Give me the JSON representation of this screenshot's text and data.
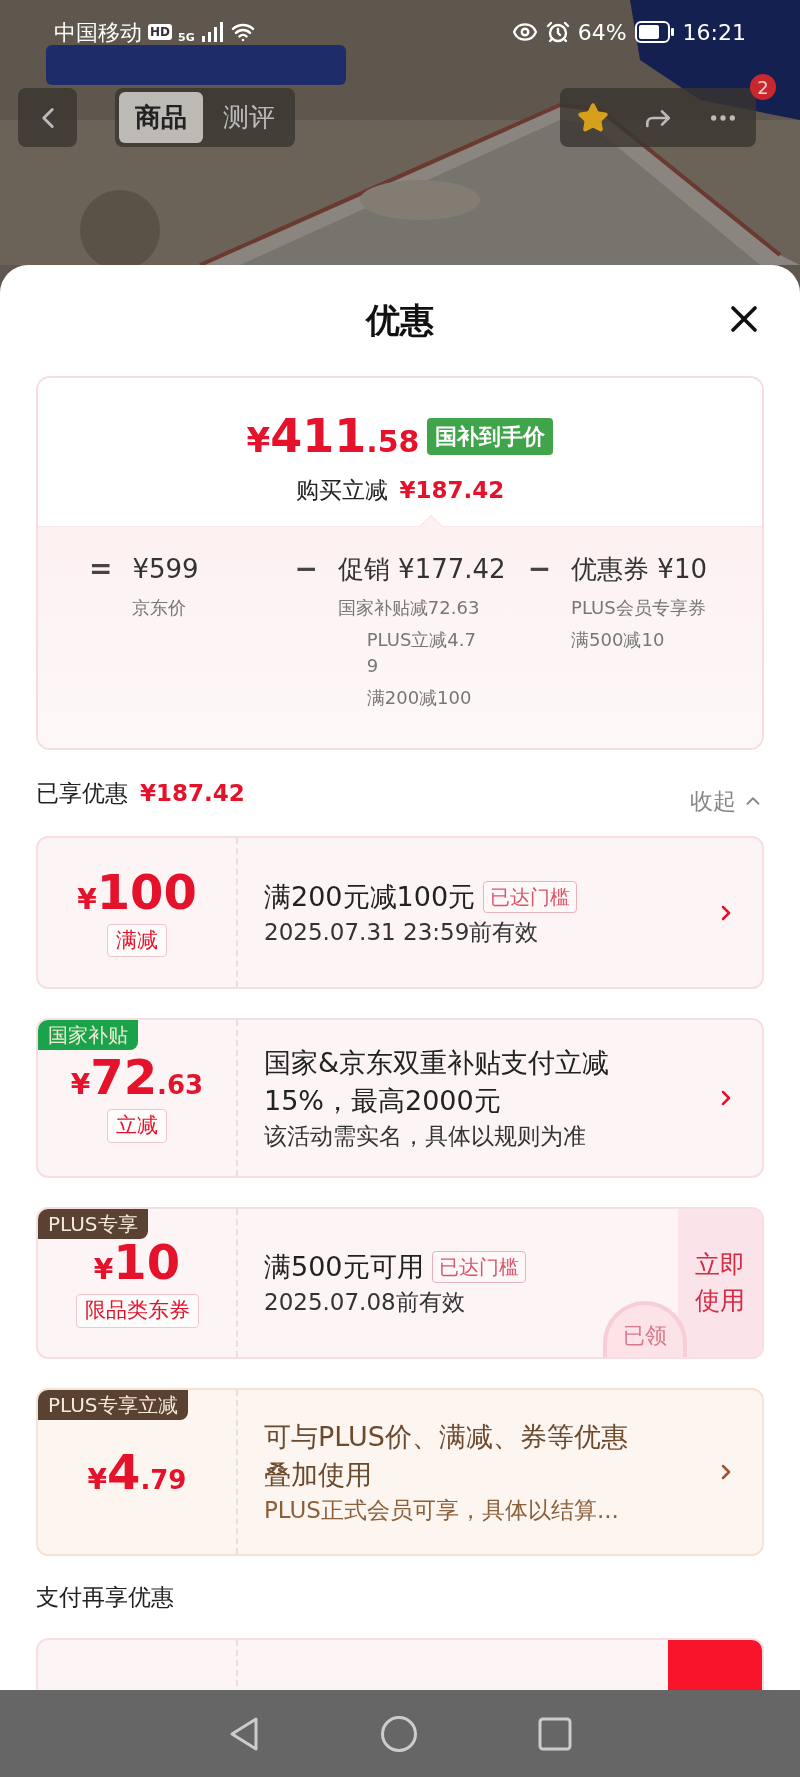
{
  "status_bar": {
    "carrier": "中国移动",
    "hd": "HD",
    "network": "5G",
    "battery": "64%",
    "time": "16:21"
  },
  "top_nav": {
    "tabs": [
      {
        "label": "商品",
        "selected": true
      },
      {
        "label": "测评",
        "selected": false
      }
    ],
    "more_badge": "2"
  },
  "sheet": {
    "title": "优惠"
  },
  "price_card": {
    "currency": "¥",
    "integer": "411",
    "decimal": ".58",
    "tag": "国补到手价",
    "saving_label": "购买立减",
    "saving": "¥187.42",
    "breakdown": [
      {
        "operator": "=",
        "value": "¥599",
        "notes": [
          "京东价"
        ]
      },
      {
        "operator": "−",
        "value": "促销 ¥177.42",
        "notes": [
          "国家补贴减72.63",
          "PLUS立减4.79",
          "满200减100"
        ]
      },
      {
        "operator": "−",
        "value": "优惠券 ¥10",
        "notes": [
          "PLUS会员专享券",
          "满500减10"
        ]
      }
    ]
  },
  "enjoyed": {
    "label": "已享优惠",
    "amount": "¥187.42",
    "toggle": "收起",
    "expanded": true
  },
  "coupons": [
    {
      "kind": "standard",
      "currency": "¥",
      "integer": "100",
      "label": "满减",
      "title": "满200元减100元",
      "badge": "已达门槛",
      "lines": [
        "2025.07.31 23:59前有效"
      ],
      "action": {
        "kind": "chevron"
      }
    },
    {
      "kind": "standard",
      "ribbon": {
        "text": "国家补贴",
        "color": "#1aa34a"
      },
      "currency": "¥",
      "integer": "72",
      "decimal": ".63",
      "label": "立减",
      "title": "国家&京东双重补贴支付立减15%，最高2000元",
      "lines": [
        "该活动需实名，具体以规则为准"
      ],
      "action": {
        "kind": "chevron"
      }
    },
    {
      "kind": "standard",
      "ribbon": {
        "text": "PLUS专享",
        "color": "#5a4232"
      },
      "currency": "¥",
      "integer": "10",
      "label": "限品类东券",
      "title": "满500元可用",
      "badge": "已达门槛",
      "lines": [
        "2025.07.08前有效"
      ],
      "stamp": "已领",
      "action": {
        "kind": "button",
        "text": "立即使用"
      }
    },
    {
      "kind": "plus",
      "ribbon": {
        "text": "PLUS专享立减",
        "color": "#5a4232"
      },
      "currency": "¥",
      "integer": "4",
      "decimal": ".79",
      "title": "可与PLUS价、满减、券等优惠叠加使用",
      "lines": [
        "PLUS正式会员可享，具体以结算..."
      ],
      "action": {
        "kind": "chevron"
      }
    }
  ],
  "pay_section": {
    "title": "支付再享优惠"
  }
}
